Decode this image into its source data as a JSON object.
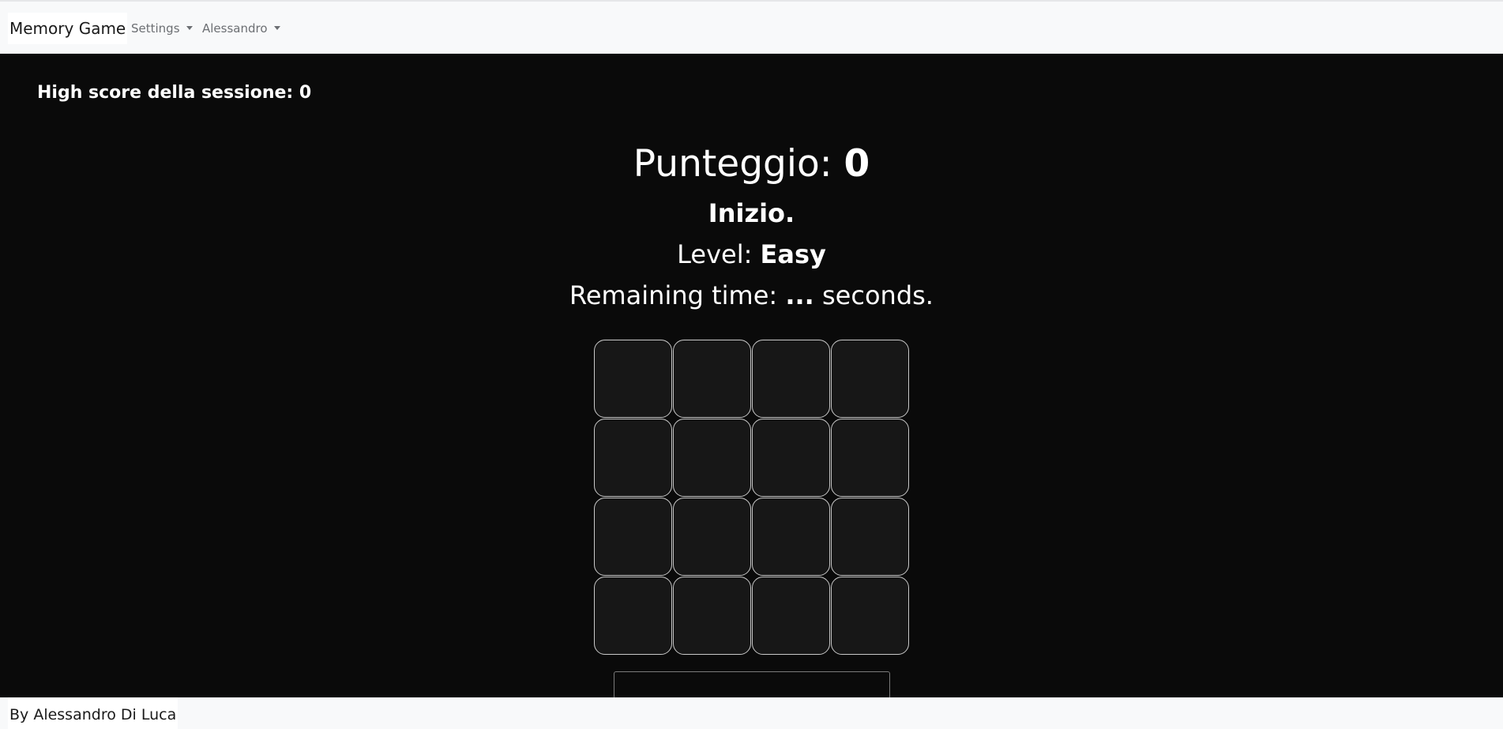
{
  "navbar": {
    "brand": "Memory Game",
    "settings_label": "Settings",
    "user_label": "Alessandro"
  },
  "highscore": {
    "label": "High score della sessione:",
    "value": "0"
  },
  "score": {
    "label": "Punteggio:",
    "value": "0"
  },
  "status": "Inizio.",
  "level": {
    "label": "Level:",
    "value": "Easy"
  },
  "time": {
    "label": "Remaining time:",
    "value": "...",
    "suffix": "seconds."
  },
  "board": {
    "rows": 4,
    "columns": 4
  },
  "footer": {
    "text": "By Alessandro Di Luca"
  },
  "colors": {
    "navbar_bg": "#f8f9fa",
    "main_bg": "#0a0a0a",
    "card_bg": "#171717",
    "card_border": "#c9c9c9",
    "text_light": "#ffffff"
  }
}
